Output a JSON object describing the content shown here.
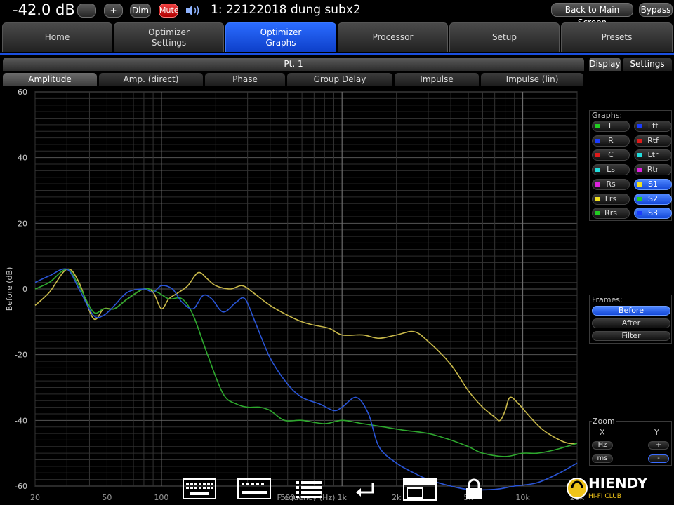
{
  "topbar": {
    "volume": "-42.0 dB",
    "vol_down_label": "-",
    "vol_up_label": "+",
    "dim_label": "Dim",
    "mute_label": "Mute",
    "preset_name": "1: 22122018 dung subx2",
    "back_label": "Back to Main Screen",
    "bypass_label": "Bypass"
  },
  "main_tabs": [
    {
      "label": "Home",
      "active": false
    },
    {
      "label": "Optimizer\nSettings",
      "active": false
    },
    {
      "label": "Optimizer\nGraphs",
      "active": true
    },
    {
      "label": "Processor",
      "active": false
    },
    {
      "label": "Setup",
      "active": false
    },
    {
      "label": "Presets",
      "active": false
    }
  ],
  "point_label": "Pt. 1",
  "sub_tabs": [
    {
      "label": "Amplitude",
      "active": true
    },
    {
      "label": "Amp. (direct)",
      "active": false
    },
    {
      "label": "Phase",
      "active": false
    },
    {
      "label": "Group Delay",
      "active": false
    },
    {
      "label": "Impulse",
      "active": false
    },
    {
      "label": "Impulse (lin)",
      "active": false
    }
  ],
  "right_tabs": [
    {
      "label": "Display",
      "active": true
    },
    {
      "label": "Settings",
      "active": false
    }
  ],
  "graphs_panel": {
    "title": "Graphs:",
    "channels": [
      {
        "label": "L",
        "color": "#22cc22",
        "on": false
      },
      {
        "label": "Ltf",
        "color": "#1a3cff",
        "on": false
      },
      {
        "label": "R",
        "color": "#1a3cff",
        "on": false
      },
      {
        "label": "Rtf",
        "color": "#dd1a1a",
        "on": false
      },
      {
        "label": "C",
        "color": "#dd1a1a",
        "on": false
      },
      {
        "label": "Ltr",
        "color": "#22dddd",
        "on": false
      },
      {
        "label": "Ls",
        "color": "#22dddd",
        "on": false
      },
      {
        "label": "Rtr",
        "color": "#dd22dd",
        "on": false
      },
      {
        "label": "Rs",
        "color": "#dd22dd",
        "on": false
      },
      {
        "label": "S1",
        "color": "#f0e020",
        "on": true
      },
      {
        "label": "Lrs",
        "color": "#f0e020",
        "on": false
      },
      {
        "label": "S2",
        "color": "#22cc22",
        "on": true
      },
      {
        "label": "Rrs",
        "color": "#22cc22",
        "on": false
      },
      {
        "label": "S3",
        "color": "#1a3cff",
        "on": true
      }
    ]
  },
  "frames_panel": {
    "title": "Frames:",
    "items": [
      {
        "label": "Before",
        "on": true
      },
      {
        "label": "After",
        "on": false
      },
      {
        "label": "Filter",
        "on": false
      }
    ]
  },
  "zoom_panel": {
    "title": "Zoom",
    "x_label": "X",
    "y_label": "Y",
    "hz_label": "Hz",
    "ms_label": "ms",
    "y_plus": "+",
    "y_minus": "-"
  },
  "chart_data": {
    "type": "line",
    "xlabel": "Frequency (Hz)",
    "ylabel": "Before (dB)",
    "xscale": "log",
    "xlim": [
      20,
      20000
    ],
    "ylim": [
      -60,
      60
    ],
    "x_ticks": [
      "20",
      "50",
      "100",
      "500",
      "1k",
      "2k",
      "5k",
      "10k",
      "20k"
    ],
    "x_tick_values": [
      20,
      50,
      100,
      500,
      1000,
      2000,
      5000,
      10000,
      20000
    ],
    "y_ticks": [
      60,
      40,
      20,
      0,
      -20,
      -40,
      -60
    ],
    "grid": true,
    "series": [
      {
        "channel": "S1",
        "color": "#c8b84a",
        "points": [
          [
            20,
            -5
          ],
          [
            24,
            -1
          ],
          [
            30,
            6
          ],
          [
            35,
            2
          ],
          [
            42,
            -9
          ],
          [
            48,
            -6
          ],
          [
            55,
            -6
          ],
          [
            65,
            -3
          ],
          [
            80,
            0
          ],
          [
            90,
            -1
          ],
          [
            100,
            -6
          ],
          [
            110,
            -3
          ],
          [
            125,
            -1
          ],
          [
            140,
            1
          ],
          [
            160,
            5
          ],
          [
            180,
            3
          ],
          [
            200,
            1
          ],
          [
            240,
            0
          ],
          [
            280,
            1
          ],
          [
            320,
            -1
          ],
          [
            400,
            -5
          ],
          [
            500,
            -8
          ],
          [
            600,
            -10
          ],
          [
            700,
            -11
          ],
          [
            850,
            -12
          ],
          [
            1000,
            -14
          ],
          [
            1300,
            -14
          ],
          [
            1600,
            -15
          ],
          [
            2000,
            -14
          ],
          [
            2500,
            -13
          ],
          [
            3000,
            -16
          ],
          [
            4000,
            -23
          ],
          [
            5000,
            -31
          ],
          [
            6000,
            -36
          ],
          [
            7000,
            -39
          ],
          [
            7500,
            -40
          ],
          [
            8000,
            -37
          ],
          [
            8500,
            -33
          ],
          [
            9500,
            -35
          ],
          [
            11000,
            -39
          ],
          [
            13000,
            -43
          ],
          [
            16000,
            -46
          ],
          [
            18000,
            -47
          ],
          [
            20000,
            -47
          ]
        ]
      },
      {
        "channel": "S2",
        "color": "#2ea82e",
        "points": [
          [
            20,
            0
          ],
          [
            24,
            2
          ],
          [
            30,
            6
          ],
          [
            35,
            1
          ],
          [
            42,
            -7
          ],
          [
            48,
            -6
          ],
          [
            55,
            -6
          ],
          [
            65,
            -3
          ],
          [
            80,
            0
          ],
          [
            95,
            -1
          ],
          [
            110,
            -3
          ],
          [
            130,
            -3
          ],
          [
            150,
            -8
          ],
          [
            180,
            -20
          ],
          [
            220,
            -32
          ],
          [
            260,
            -35
          ],
          [
            300,
            -36
          ],
          [
            350,
            -36
          ],
          [
            400,
            -37
          ],
          [
            480,
            -40
          ],
          [
            600,
            -40
          ],
          [
            800,
            -41
          ],
          [
            1000,
            -40
          ],
          [
            1300,
            -41
          ],
          [
            1700,
            -42
          ],
          [
            2200,
            -43
          ],
          [
            3000,
            -44
          ],
          [
            4000,
            -46
          ],
          [
            5000,
            -48
          ],
          [
            6000,
            -50
          ],
          [
            8000,
            -51
          ],
          [
            10000,
            -50
          ],
          [
            12000,
            -50
          ],
          [
            15000,
            -49
          ],
          [
            20000,
            -47
          ]
        ]
      },
      {
        "channel": "S3",
        "color": "#2a55d6",
        "points": [
          [
            20,
            2
          ],
          [
            24,
            4
          ],
          [
            30,
            6
          ],
          [
            35,
            0
          ],
          [
            42,
            -8
          ],
          [
            48,
            -8
          ],
          [
            55,
            -5
          ],
          [
            65,
            -1
          ],
          [
            80,
            0
          ],
          [
            90,
            -1
          ],
          [
            100,
            1
          ],
          [
            115,
            0
          ],
          [
            130,
            -4
          ],
          [
            150,
            -6
          ],
          [
            170,
            -2
          ],
          [
            190,
            -3
          ],
          [
            220,
            -7
          ],
          [
            260,
            -4
          ],
          [
            290,
            -3
          ],
          [
            330,
            -10
          ],
          [
            400,
            -21
          ],
          [
            500,
            -29
          ],
          [
            600,
            -33
          ],
          [
            750,
            -35
          ],
          [
            900,
            -37
          ],
          [
            1000,
            -36
          ],
          [
            1200,
            -33
          ],
          [
            1400,
            -38
          ],
          [
            1600,
            -48
          ],
          [
            2000,
            -53
          ],
          [
            2500,
            -56
          ],
          [
            3000,
            -58
          ],
          [
            4000,
            -60
          ],
          [
            5000,
            -61
          ],
          [
            7000,
            -61
          ],
          [
            9000,
            -60
          ],
          [
            12000,
            -59
          ],
          [
            16000,
            -56
          ],
          [
            20000,
            -53
          ]
        ]
      }
    ]
  },
  "toolbar_icons": [
    "keyboard-icon",
    "keypad-icon",
    "list-icon",
    "enter-icon",
    "window-icon",
    "lock-icon"
  ],
  "logo": {
    "text": "HIENDY",
    "subtext": "HI-FI CLUB"
  }
}
